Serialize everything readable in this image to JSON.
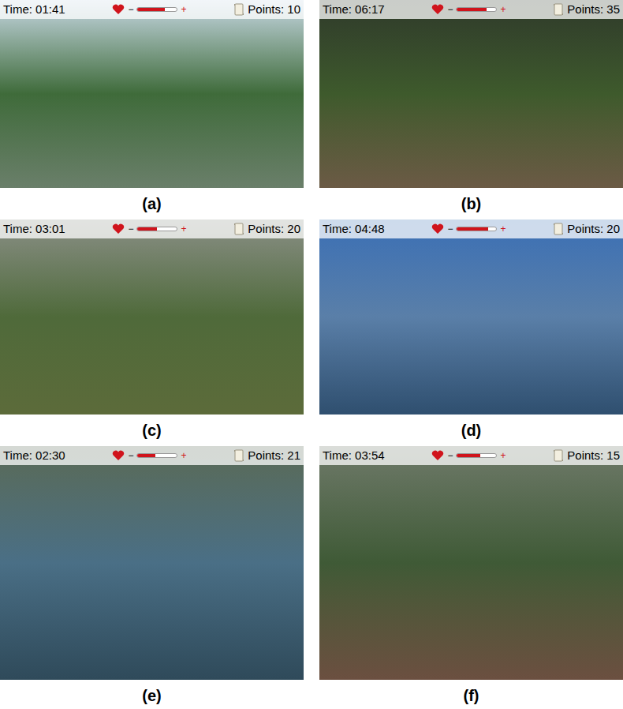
{
  "hud": {
    "minus": "−",
    "plus": "+"
  },
  "panels": [
    {
      "label": "(a)",
      "time": "Time: 01:41",
      "points": "Points: 10",
      "health": {
        "level": 0.7
      }
    },
    {
      "label": "(b)",
      "time": "Time: 06:17",
      "points": "Points: 35",
      "health": {
        "level": 0.75
      }
    },
    {
      "label": "(c)",
      "time": "Time: 03:01",
      "points": "Points: 20",
      "health": {
        "level": 0.5
      }
    },
    {
      "label": "(d)",
      "time": "Time: 04:48",
      "points": "Points: 20",
      "health": {
        "level": 0.8
      }
    },
    {
      "label": "(e)",
      "time": "Time: 02:30",
      "points": "Points: 21",
      "health": {
        "level": 0.45
      }
    },
    {
      "label": "(f)",
      "time": "Time: 03:54",
      "points": "Points: 15",
      "health": {
        "level": 0.6
      }
    }
  ]
}
